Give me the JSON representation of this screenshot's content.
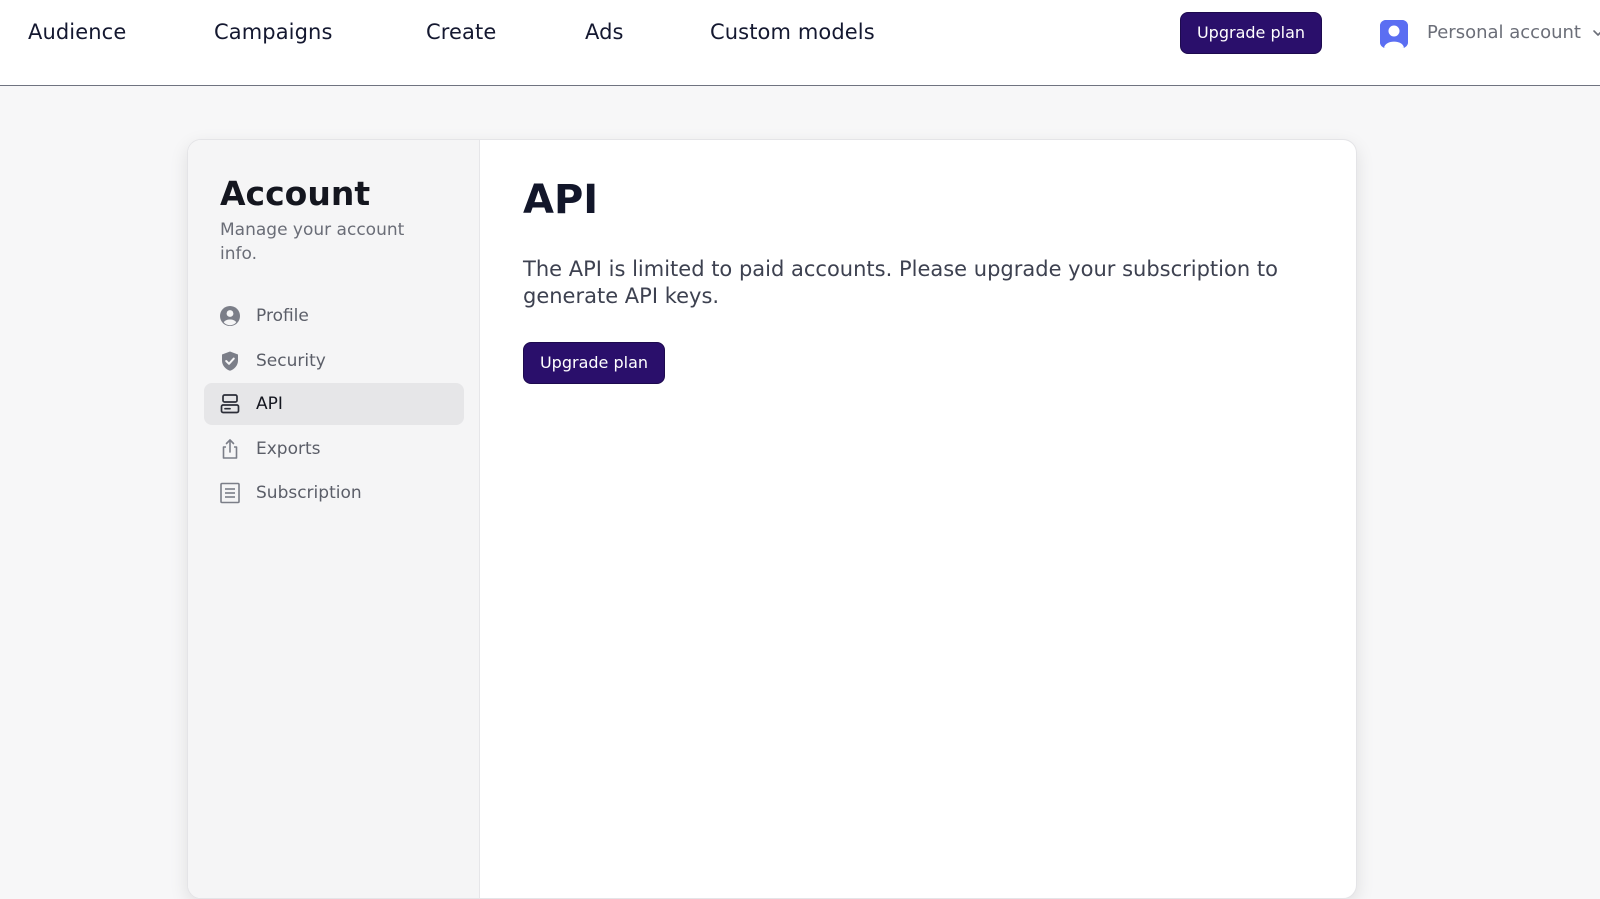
{
  "nav": {
    "items": [
      {
        "label": "Audience"
      },
      {
        "label": "Campaigns"
      },
      {
        "label": "Create"
      },
      {
        "label": "Ads"
      },
      {
        "label": "Custom models"
      }
    ],
    "upgrade_label": "Upgrade plan",
    "account_label": "Personal account"
  },
  "sidebar": {
    "title": "Account",
    "subtitle": "Manage your account info.",
    "items": [
      {
        "label": "Profile",
        "icon": "user-circle-icon"
      },
      {
        "label": "Security",
        "icon": "shield-check-icon"
      },
      {
        "label": "API",
        "icon": "server-icon",
        "active": true
      },
      {
        "label": "Exports",
        "icon": "share-icon"
      },
      {
        "label": "Subscription",
        "icon": "receipt-icon"
      }
    ]
  },
  "main": {
    "title": "API",
    "message": "The API is limited to paid accounts. Please upgrade your subscription to generate API keys.",
    "upgrade_label": "Upgrade plan"
  },
  "colors": {
    "brand": "#2a0f6b",
    "avatar": "#5b6ef2",
    "background": "#f7f7f8"
  }
}
